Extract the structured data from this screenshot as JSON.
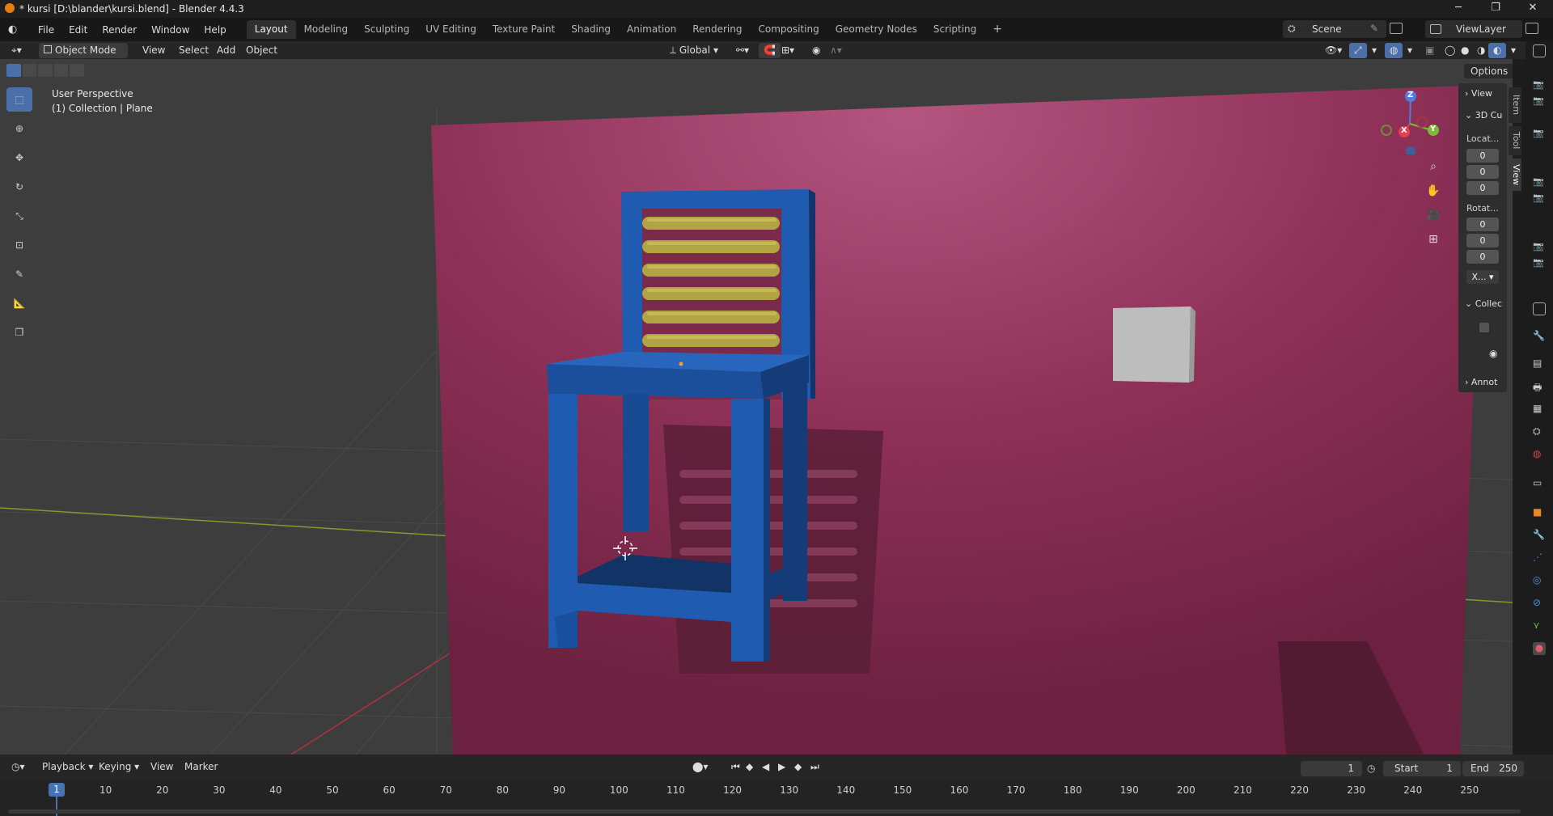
{
  "window": {
    "title": "* kursi [D:\\blander\\kursi.blend] - Blender 4.4.3"
  },
  "menubar": {
    "items": [
      "File",
      "Edit",
      "Render",
      "Window",
      "Help"
    ]
  },
  "workspaces": {
    "tabs": [
      "Layout",
      "Modeling",
      "Sculpting",
      "UV Editing",
      "Texture Paint",
      "Shading",
      "Animation",
      "Rendering",
      "Compositing",
      "Geometry Nodes",
      "Scripting"
    ],
    "active": "Layout",
    "add": "+"
  },
  "scene": {
    "scene_name": "Scene",
    "view_layer": "ViewLayer"
  },
  "header3d": {
    "mode": "Object Mode",
    "menus": [
      "View",
      "Select",
      "Add",
      "Object"
    ],
    "orientation": "Global",
    "options": "Options"
  },
  "viewport": {
    "perspective": "User Perspective",
    "collection_info": "(1) Collection | Plane",
    "colors": {
      "wall": "#8a3055",
      "chair": "#1f5bb0",
      "slats": "#b3a443",
      "cube": "#bdbdbd",
      "floor": "#3e3e3e"
    }
  },
  "gizmo": {
    "z": "Z",
    "x": "X",
    "y": "Y"
  },
  "npanel": {
    "view": "View",
    "cursor": "3D Cu",
    "location_label": "Locat...",
    "location": [
      "0",
      "0",
      "0"
    ],
    "rotation_label": "Rotat...",
    "rotation": [
      "0",
      "0",
      "0"
    ],
    "rotation_mode": "X...",
    "collection": "Collec",
    "annotations": "Annot",
    "tabs": [
      "Item",
      "Tool",
      "View"
    ]
  },
  "timeline": {
    "menus": [
      "Playback",
      "Keying",
      "View",
      "Marker"
    ],
    "current_frame": "1",
    "start_label": "Start",
    "start": "1",
    "end_label": "End",
    "end": "250",
    "ruler": [
      "10",
      "20",
      "30",
      "40",
      "50",
      "60",
      "70",
      "80",
      "90",
      "100",
      "110",
      "120",
      "130",
      "140",
      "150",
      "160",
      "170",
      "180",
      "190",
      "200",
      "210",
      "220",
      "230",
      "240",
      "250"
    ],
    "playhead": "1"
  }
}
